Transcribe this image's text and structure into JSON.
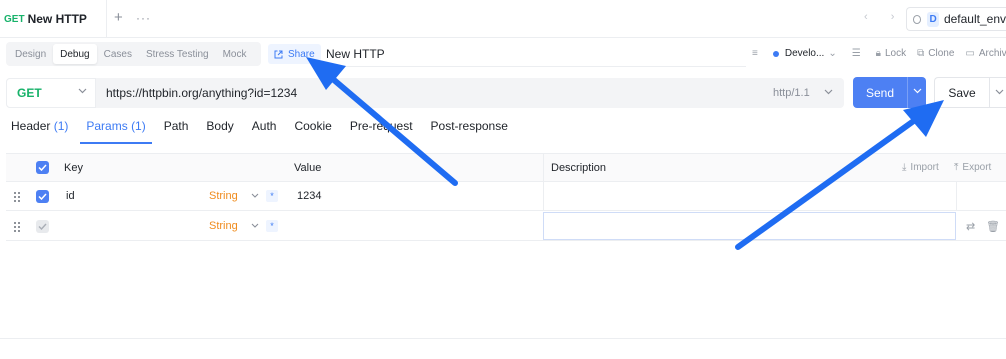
{
  "tabbar": {
    "tab_method": "GET",
    "tab_title": "New HTTP",
    "add_label": "+",
    "more_label": "···",
    "nav_arrows": "‹ ›",
    "env_badge": "D",
    "env_name": "default_env"
  },
  "modes": [
    "Design",
    "Debug",
    "Cases",
    "Stress Testing",
    "Mock"
  ],
  "active_mode": "Debug",
  "share_label": "Share",
  "request_name": "New HTTP",
  "tools": {
    "env_label": "Develo...",
    "lock_label": "Lock",
    "clone_label": "Clone",
    "archive_label": "Archive"
  },
  "urlbar": {
    "method": "GET",
    "url": "https://httpbin.org/anything?id=1234",
    "http_version": "http/1.1",
    "send_label": "Send",
    "save_label": "Save"
  },
  "param_tabs": [
    {
      "label": "Header",
      "count": "(1)"
    },
    {
      "label": "Params",
      "count": "(1)"
    },
    {
      "label": "Path",
      "count": ""
    },
    {
      "label": "Body",
      "count": ""
    },
    {
      "label": "Auth",
      "count": ""
    },
    {
      "label": "Cookie",
      "count": ""
    },
    {
      "label": "Pre-request",
      "count": ""
    },
    {
      "label": "Post-response",
      "count": ""
    }
  ],
  "table": {
    "headers": {
      "key": "Key",
      "value": "Value",
      "description": "Description"
    },
    "import_label": "Import",
    "export_label": "Export",
    "rows": [
      {
        "key": "id",
        "type": "String",
        "value": "1234",
        "description": "",
        "checked": true
      },
      {
        "key": "",
        "type": "String",
        "value": "",
        "description": "",
        "checked": false
      }
    ]
  },
  "colors": {
    "accent": "#4d80f3",
    "method_get": "#17b26a",
    "type_string": "#f08c1e",
    "annotation_arrow": "#1f6cf2"
  }
}
